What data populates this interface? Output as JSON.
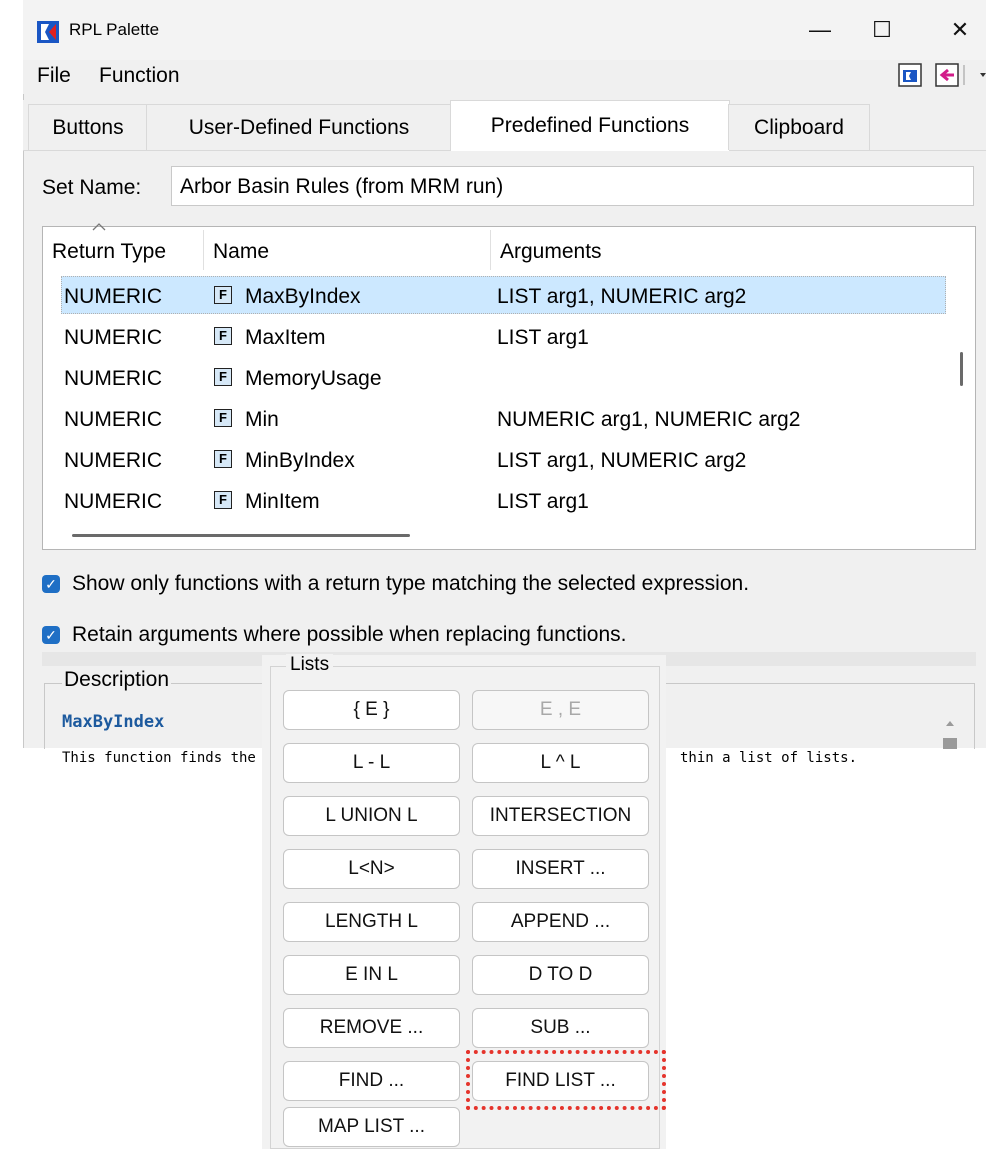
{
  "window": {
    "title": "RPL Palette",
    "controls": {
      "minimize": "—",
      "maximize": "☐",
      "close": "✕"
    }
  },
  "menu": {
    "file": "File",
    "function": "Function"
  },
  "toolbar": {
    "icon1": "rpl-doc-icon",
    "icon2": "insert-arrow-icon"
  },
  "tabs": [
    "Buttons",
    "User-Defined Functions",
    "Predefined Functions",
    "Clipboard"
  ],
  "selected_tab": "Predefined Functions",
  "set_name": {
    "label": "Set Name:",
    "value": "Arbor Basin Rules (from MRM run)"
  },
  "table": {
    "headers": [
      "Return Type",
      "Name",
      "Arguments"
    ],
    "rows": [
      {
        "return_type": "NUMERIC",
        "name": "MaxByIndex",
        "arguments": "LIST arg1, NUMERIC arg2"
      },
      {
        "return_type": "NUMERIC",
        "name": "MaxItem",
        "arguments": "LIST arg1"
      },
      {
        "return_type": "NUMERIC",
        "name": "MemoryUsage",
        "arguments": ""
      },
      {
        "return_type": "NUMERIC",
        "name": "Min",
        "arguments": "NUMERIC arg1, NUMERIC arg2"
      },
      {
        "return_type": "NUMERIC",
        "name": "MinByIndex",
        "arguments": "LIST arg1, NUMERIC arg2"
      },
      {
        "return_type": "NUMERIC",
        "name": "MinItem",
        "arguments": "LIST arg1"
      }
    ],
    "func_icon_glyph": "F"
  },
  "options": {
    "show_only": "Show only functions with a return type matching the selected expression.",
    "retain_args": "Retain arguments where possible when replacing functions."
  },
  "description": {
    "title": "Description",
    "fn_name": "MaxByIndex",
    "text_left": "This function finds the r",
    "text_right": "thin a list of lists."
  },
  "lists_group": {
    "title": "Lists",
    "buttons": [
      {
        "label": "{ E }",
        "enabled": true
      },
      {
        "label": "E , E",
        "enabled": false
      },
      {
        "label": "L - L",
        "enabled": true
      },
      {
        "label": "L ^ L",
        "enabled": true
      },
      {
        "label": "L UNION L",
        "enabled": true
      },
      {
        "label": "INTERSECTION",
        "enabled": true
      },
      {
        "label": "L<N>",
        "enabled": true
      },
      {
        "label": "INSERT ...",
        "enabled": true
      },
      {
        "label": "LENGTH L",
        "enabled": true
      },
      {
        "label": "APPEND ...",
        "enabled": true
      },
      {
        "label": "E IN L",
        "enabled": true
      },
      {
        "label": "D TO D",
        "enabled": true
      },
      {
        "label": "REMOVE ...",
        "enabled": true
      },
      {
        "label": "SUB ...",
        "enabled": true
      },
      {
        "label": "FIND ...",
        "enabled": true
      },
      {
        "label": "FIND LIST ...",
        "enabled": true
      },
      {
        "label": "MAP LIST ...",
        "enabled": true
      }
    ],
    "highlighted": "FIND LIST ..."
  },
  "colors": {
    "accent": "#1f6fc5",
    "selection": "#cce8ff",
    "highlight": "#e5342c"
  }
}
